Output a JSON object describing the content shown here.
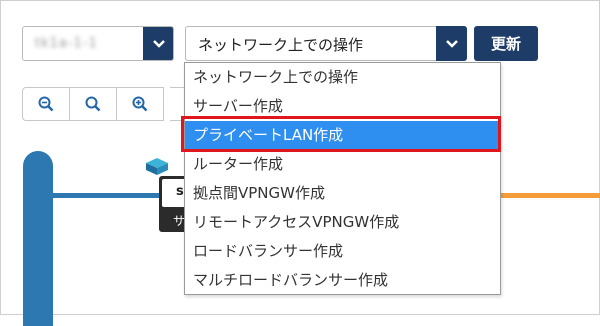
{
  "toolbar": {
    "zone_value": "tk1a-1-1",
    "operation_value": "ネットワーク上での操作",
    "update_label": "更新"
  },
  "zoom": {
    "buttons": [
      "zoom-out-icon",
      "reset-zoom-icon",
      "zoom-in-icon"
    ]
  },
  "menu": {
    "items": [
      "ネットワーク上での操作",
      "サーバー作成",
      "プライベートLAN作成",
      "ルーター作成",
      "拠点間VPNGW作成",
      "リモートアクセスVPNGW作成",
      "ロードバランサー作成",
      "マルチロードバランサー作成"
    ],
    "selected_index": 2
  },
  "diagram": {
    "server_label_partial": "s",
    "server_sub_partial": "サ"
  },
  "colors": {
    "navy": "#1d3d68",
    "accent_blue": "#2e78b2",
    "selection_blue": "#2e8ff0",
    "highlight_red": "#e0161d",
    "orange_line": "#f39c38"
  }
}
